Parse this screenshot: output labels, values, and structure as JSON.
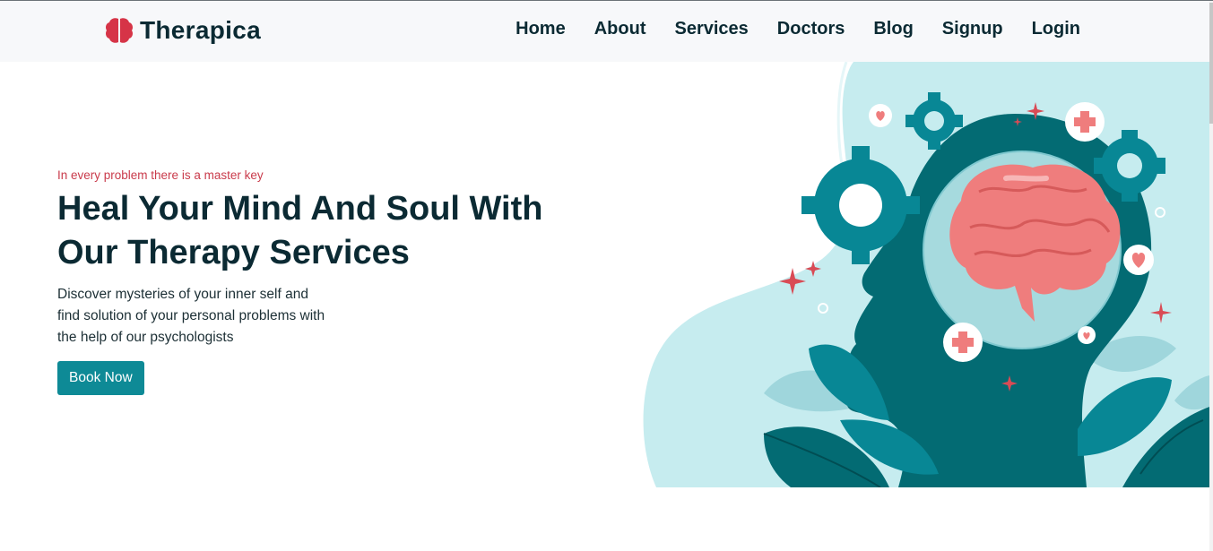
{
  "brand": {
    "name": "Therapica",
    "icon": "brain-icon",
    "icon_color": "#d63447"
  },
  "nav": {
    "items": [
      {
        "label": "Home"
      },
      {
        "label": "About"
      },
      {
        "label": "Services"
      },
      {
        "label": "Doctors"
      },
      {
        "label": "Blog"
      },
      {
        "label": "Signup"
      },
      {
        "label": "Login"
      }
    ]
  },
  "hero": {
    "tagline": "In every problem there is a master key",
    "headline_line1": "Heal Your Mind And Soul With",
    "headline_line2": "Our Therapy Services",
    "desc_line1": "Discover mysteries of your inner self and",
    "desc_line2": "find solution of your personal problems with",
    "desc_line3": "the help of our psychologists",
    "cta_label": "Book Now"
  },
  "colors": {
    "accent": "#0e8a96",
    "tagline": "#c93b4b",
    "text": "#0b2a33",
    "navbar_bg": "#f7f8fa"
  },
  "illustration": {
    "icon": "head-brain-illustration"
  }
}
